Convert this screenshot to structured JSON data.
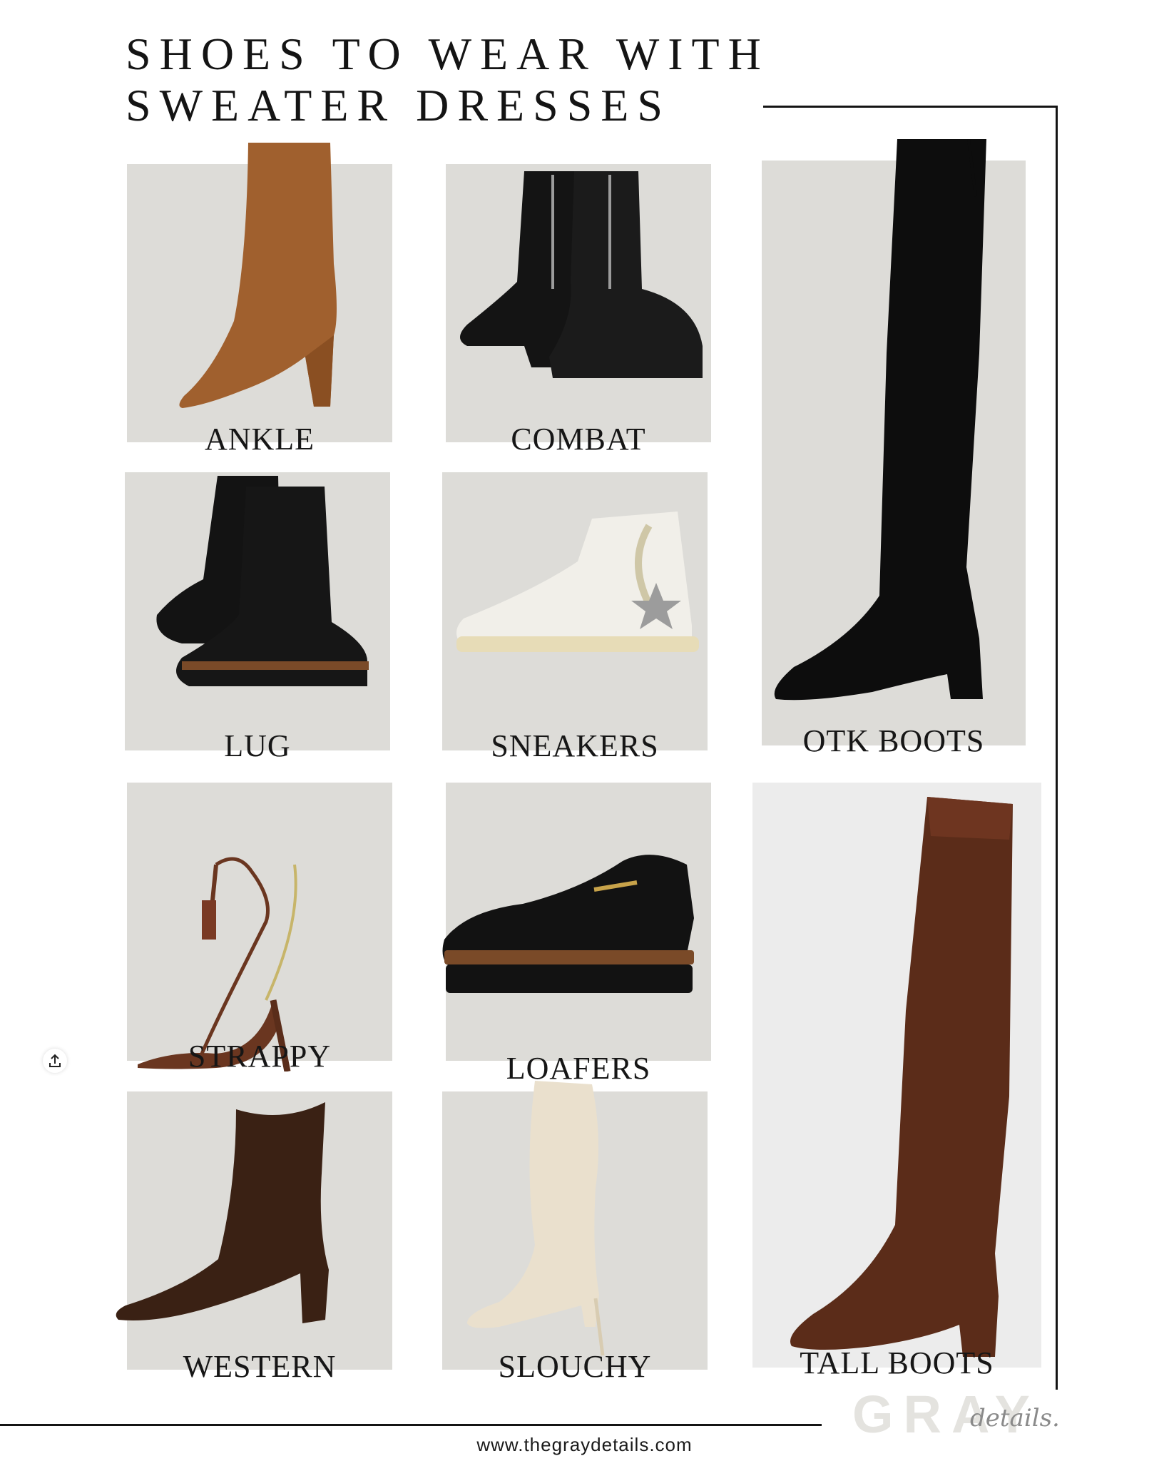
{
  "title": {
    "line1": "SHOES TO WEAR WITH",
    "line2": "SWEATER DRESSES"
  },
  "items": {
    "ankle": "ANKLE",
    "combat": "COMBAT",
    "lug": "LUG",
    "sneakers": "SNEAKERS",
    "otk": "OTK BOOTS",
    "strappy": "STRAPPY",
    "loafers": "LOAFERS",
    "western": "WESTERN",
    "slouchy": "SLOUCHY",
    "tall": "TALL BOOTS"
  },
  "brand": {
    "watermark": "GRAY",
    "script": "details.",
    "url": "www.thegraydetails.com"
  },
  "icons": {
    "share": "share-icon"
  },
  "colors": {
    "panel": "#dddcd8",
    "text": "#141414"
  }
}
